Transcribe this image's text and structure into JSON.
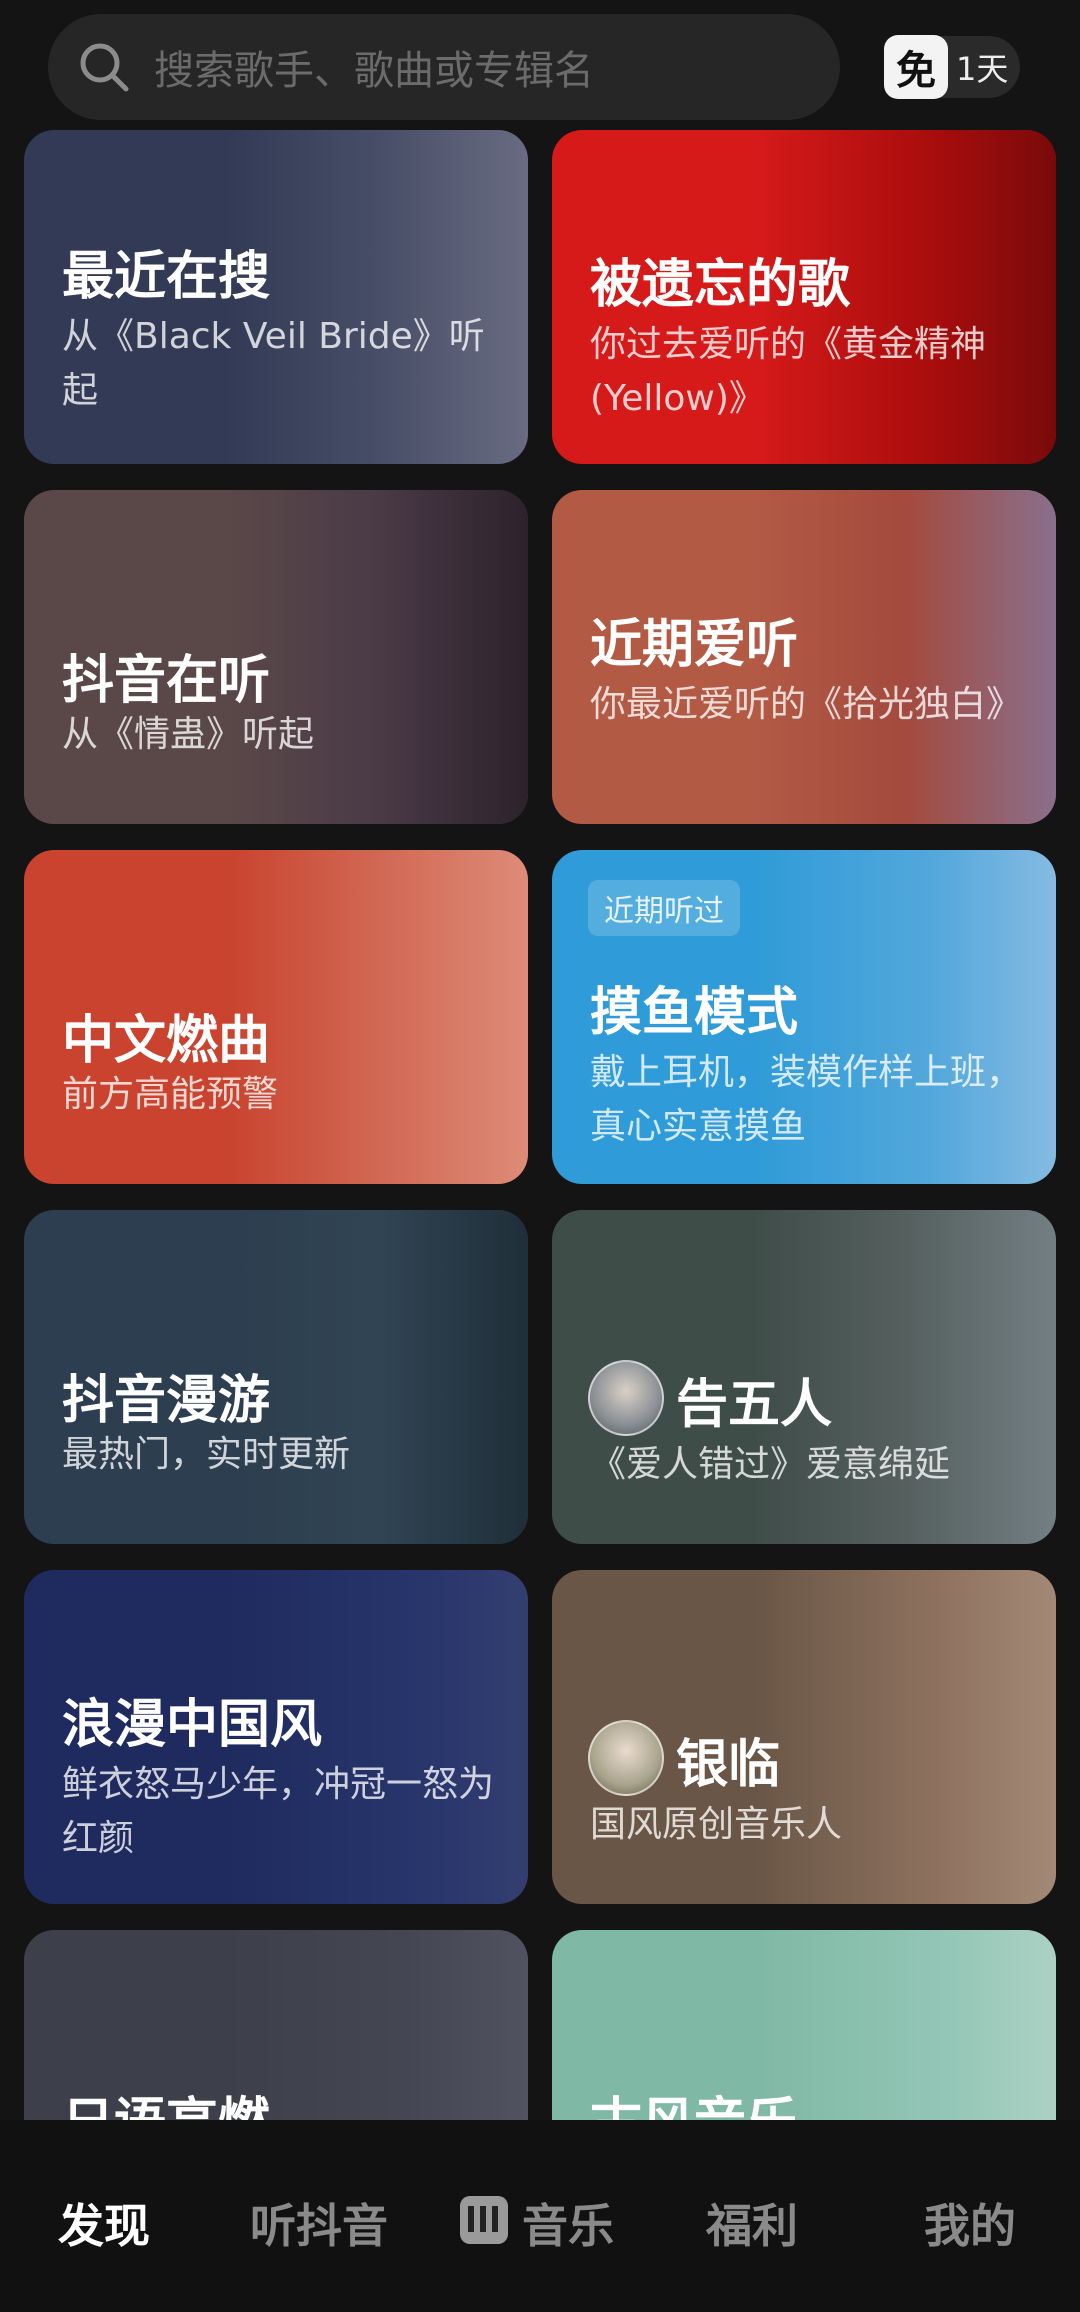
{
  "search": {
    "placeholder": "搜索歌手、歌曲或专辑名",
    "icon": "search-icon"
  },
  "free_badge": {
    "icon_text": "免",
    "label": "1天"
  },
  "cards": [
    {
      "title": "最近在搜",
      "subtitle": "从《Black Veil Bride》听起",
      "bg": "#323a55"
    },
    {
      "title": "被遗忘的歌",
      "subtitle": "你过去爱听的《黄金精神(Yellow)》",
      "bg": "#d61a1a"
    },
    {
      "title": "抖音在听",
      "subtitle": "从《情蛊》听起",
      "bg": "#5a4848"
    },
    {
      "title": "近期爱听",
      "subtitle": "你最近爱听的《拾光独白》",
      "bg": "#b35a45"
    },
    {
      "title": "中文燃曲",
      "subtitle": "前方高能预警",
      "bg": "#c9432e"
    },
    {
      "tag": "近期听过",
      "title": "摸鱼模式",
      "subtitle": "戴上耳机，装模作样上班，真心实意摸鱼",
      "bg": "#2f9bd8"
    },
    {
      "title": "抖音漫游",
      "subtitle": "最热门，实时更新",
      "bg": "#2c3e4f"
    },
    {
      "title": "告五人",
      "subtitle": "《爱人错过》爱意绵延",
      "bg": "#3f4d49"
    },
    {
      "title": "浪漫中国风",
      "subtitle": "鲜衣怒马少年，冲冠一怒为红颜",
      "bg": "#1f2b5e"
    },
    {
      "title": "银临",
      "subtitle": "国风原创音乐人",
      "bg": "#6a5646"
    },
    {
      "title": "日语高燃",
      "subtitle": "",
      "bg": "#3d3f4a"
    },
    {
      "title": "古风音乐",
      "subtitle": "",
      "bg": "#7fb8a4"
    }
  ],
  "tabs": [
    "发现",
    "听抖音",
    "音乐",
    "福利",
    "我的"
  ],
  "active_tab": "发现"
}
